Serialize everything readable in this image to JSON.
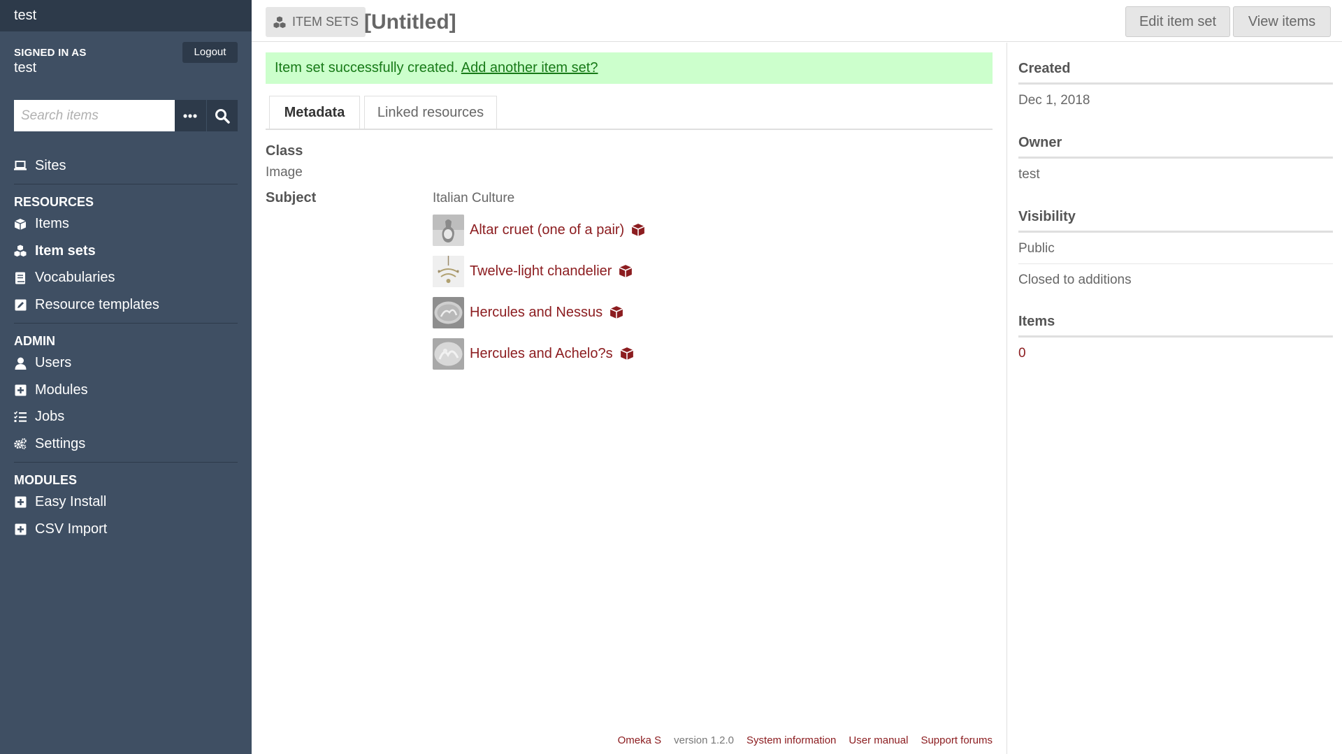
{
  "app": {
    "site_name": "test"
  },
  "user": {
    "signed_in_label": "SIGNED IN AS",
    "name": "test",
    "logout_label": "Logout"
  },
  "search": {
    "placeholder": "Search items"
  },
  "nav": {
    "sites": "Sites",
    "resources_heading": "RESOURCES",
    "items": "Items",
    "item_sets": "Item sets",
    "vocabularies": "Vocabularies",
    "resource_templates": "Resource templates",
    "admin_heading": "ADMIN",
    "users": "Users",
    "modules": "Modules",
    "jobs": "Jobs",
    "settings": "Settings",
    "modules_heading": "MODULES",
    "easy_install": "Easy Install",
    "csv_import": "CSV Import"
  },
  "header": {
    "breadcrumb": "ITEM SETS",
    "title": "[Untitled]",
    "edit_button": "Edit item set",
    "view_button": "View items"
  },
  "flash": {
    "message": "Item set successfully created. ",
    "link": "Add another item set?"
  },
  "tabs": {
    "metadata": "Metadata",
    "linked": "Linked resources"
  },
  "metadata": {
    "class_label": "Class",
    "class_value": "Image",
    "subject_label": "Subject",
    "subject_text": "Italian Culture",
    "resources": [
      {
        "title": "Altar cruet (one of a pair)"
      },
      {
        "title": "Twelve-light chandelier"
      },
      {
        "title": "Hercules and Nessus"
      },
      {
        "title": "Hercules and Achelo?s"
      }
    ]
  },
  "sidebar_meta": {
    "created_label": "Created",
    "created_value": "Dec 1, 2018",
    "owner_label": "Owner",
    "owner_value": "test",
    "visibility_label": "Visibility",
    "visibility_value": "Public",
    "additions_value": "Closed to additions",
    "items_label": "Items",
    "items_value": "0"
  },
  "footer": {
    "product": "Omeka S",
    "version": "version 1.2.0",
    "system_info": "System information",
    "user_manual": "User manual",
    "support": "Support forums"
  },
  "colors": {
    "sidebar": "#3f4f63",
    "sidebar_dark": "#2d3a4a",
    "link": "#8c1d20",
    "success_bg": "#ccffcc",
    "success_text": "#177a17"
  }
}
